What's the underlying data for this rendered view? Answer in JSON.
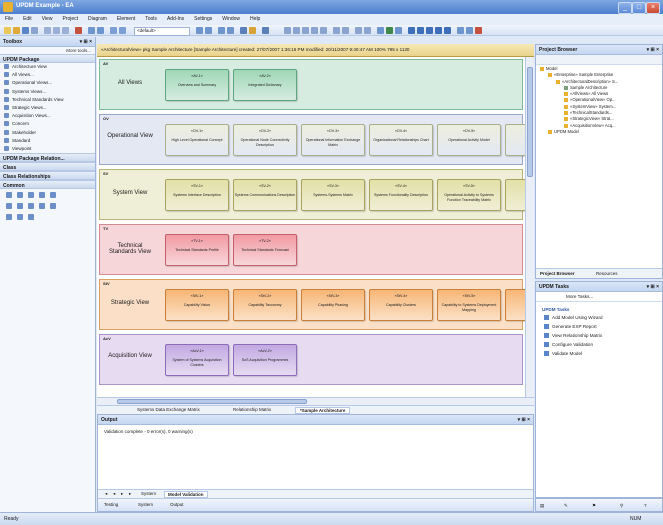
{
  "window": {
    "title": "UPDM Example - EA",
    "buttons": [
      "_",
      "□",
      "×"
    ]
  },
  "menu": [
    "File",
    "Edit",
    "View",
    "Project",
    "Diagram",
    "Element",
    "Tools",
    "Add-Ins",
    "Settings",
    "Window",
    "Help"
  ],
  "toolbar": {
    "combo_value": "<default>"
  },
  "toolbox": {
    "title": "Toolbox",
    "pin": "▾ ⊞ ×",
    "more_tools": "More tools...",
    "groups": [
      {
        "label": "UPDM Package"
      },
      {
        "label": "UPDM Package Relation..."
      },
      {
        "label": "Class"
      },
      {
        "label": "Class Relationships"
      },
      {
        "label": "Common"
      }
    ],
    "items": [
      "Architecture View",
      "All Views...",
      "Operational Views...",
      "Systems Views...",
      "Technical Standards View",
      "Strategic Views...",
      "Acquisition Views...",
      "Concern",
      "Stakeholder",
      "Standard",
      "Viewpoint"
    ]
  },
  "document": {
    "header": "«ArchitecturalView» pkg Sample Architecture [Sample Architecture]   created: 27/07/2007 1:36:16 PM   modified: 20/11/2007 9:40:47 AM   100%   795 x 1130",
    "tabs": [
      "Systems Data Exchange Matrix",
      "Relationship Matrix",
      "*Sample Architecture"
    ]
  },
  "lanes": [
    {
      "code": "AV",
      "name": "All Views",
      "elements": [
        {
          "stereotype": "«AV-1»",
          "name": "Overview and Summary"
        },
        {
          "stereotype": "«AV-2»",
          "name": "Integrated Dictionary"
        }
      ]
    },
    {
      "code": "OV",
      "name": "Operational View",
      "elements": [
        {
          "stereotype": "«OV-1»",
          "name": "High Level Operational Concept"
        },
        {
          "stereotype": "«OV-2»",
          "name": "Operational Node Connectivity Description"
        },
        {
          "stereotype": "«OV-3»",
          "name": "Operational Information Exchange Matrix"
        },
        {
          "stereotype": "«OV-4»",
          "name": "Organisational Relationships Chart"
        },
        {
          "stereotype": "«OV-5»",
          "name": "Operational Activity Model"
        },
        {
          "stereotype": "«OV-6»",
          "name": "Op... Eve..."
        }
      ]
    },
    {
      "code": "SV",
      "name": "System View",
      "elements": [
        {
          "stereotype": "«SV-1»",
          "name": "Systems Interface Description"
        },
        {
          "stereotype": "«SV-2»",
          "name": "Systems Communications Description"
        },
        {
          "stereotype": "«SV-3»",
          "name": "Systems-Systems Matrix"
        },
        {
          "stereotype": "«SV-4»",
          "name": "Systems Functionality Description"
        },
        {
          "stereotype": "«SV-5»",
          "name": "Operational Activity to Systems Function Traceability Matrix"
        },
        {
          "stereotype": "«SV-6»",
          "name": "Syste..."
        }
      ]
    },
    {
      "code": "TV",
      "name": "Technical Standards View",
      "elements": [
        {
          "stereotype": "«TV-1»",
          "name": "Technical Standards Profile"
        },
        {
          "stereotype": "«TV-2»",
          "name": "Technical Standards Forecast"
        }
      ]
    },
    {
      "code": "StV",
      "name": "Strategic View",
      "elements": [
        {
          "stereotype": "«StV-1»",
          "name": "Capability Vision"
        },
        {
          "stereotype": "«StV-2»",
          "name": "Capability Taxonomy"
        },
        {
          "stereotype": "«StV-3»",
          "name": "Capability Phasing"
        },
        {
          "stereotype": "«StV-4»",
          "name": "Capability Clusters"
        },
        {
          "stereotype": "«StV-5»",
          "name": "Capability to Systems Deployment Mapping"
        },
        {
          "stereotype": "«StV-6»",
          "name": "Cap..."
        }
      ]
    },
    {
      "code": "AcV",
      "name": "Acquisition View",
      "elements": [
        {
          "stereotype": "«AcV-1»",
          "name": "System of Systems Acquisition Clusters"
        },
        {
          "stereotype": "«AcV-2»",
          "name": "SoS Acquisition Programmes"
        }
      ]
    }
  ],
  "output": {
    "title": "Output",
    "message": "Validation complete - 0 error(s), 0 warning(s)",
    "tabs": [
      "◂",
      "◂",
      "▸",
      "▸",
      "System",
      "Model Validation"
    ],
    "bottom_tabs": [
      "Testing",
      "System",
      "Output"
    ]
  },
  "project_browser": {
    "title": "Project Browser",
    "tree": [
      "Model",
      "«Enterprise» Sample Enterprise",
      "«ArchitecturalDescription» S...",
      "Sample Architecture",
      "«AllViews» All Views",
      "«OperationalView» Op...",
      "«SystemView» System...",
      "«TechnicalStandards...",
      "«StrategicView» Strat...",
      "«AcquisitionView» Acq...",
      "UPDM Model"
    ],
    "tabs": [
      "Project Browser",
      "Resources"
    ]
  },
  "tasks": {
    "title": "UPDM Tasks",
    "more": "More Tasks...",
    "section": "UPDM Tasks",
    "items": [
      "Add Model Using Wizard",
      "Generate EXP Report",
      "View Relationship Matrix",
      "Configure Validation",
      "Validate Model"
    ]
  },
  "status": {
    "left": "Ready",
    "right": "NUM"
  },
  "colors": {
    "AV": "#cfe7d8",
    "OV": "#dfe3f0",
    "SV": "#eeebcf",
    "TV": "#f7cfd3",
    "StV": "#fbdcc0",
    "AcV": "#e3d6ef"
  }
}
